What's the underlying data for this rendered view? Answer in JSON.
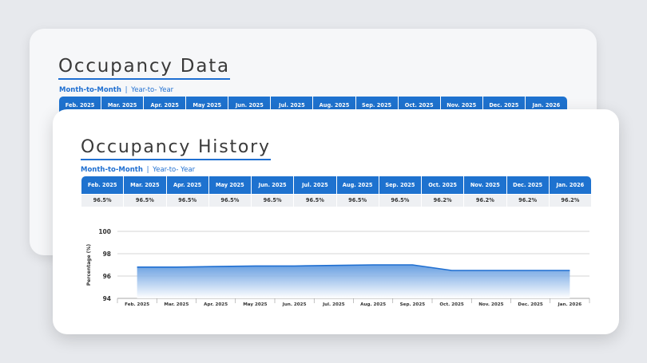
{
  "back_card": {
    "title": "Occupancy Data",
    "toggle": {
      "active": "Month-to-Month",
      "separator": "|",
      "inactive": "Year-to- Year"
    },
    "months": [
      "Feb. 2025",
      "Mar. 2025",
      "Apr. 2025",
      "May 2025",
      "Jun. 2025",
      "Jul. 2025",
      "Aug. 2025",
      "Sep. 2025",
      "Oct. 2025",
      "Nov. 2025",
      "Dec. 2025",
      "Jan. 2026"
    ]
  },
  "front_card": {
    "title": "Occupancy History",
    "toggle": {
      "active": "Month-to-Month",
      "separator": "|",
      "inactive": "Year-to- Year"
    },
    "months": [
      "Feb. 2025",
      "Mar. 2025",
      "Apr. 2025",
      "May 2025",
      "Jun. 2025",
      "Jul. 2025",
      "Aug. 2025",
      "Sep. 2025",
      "Oct. 2025",
      "Nov. 2025",
      "Dec. 2025",
      "Jan. 2026"
    ],
    "values": [
      "96.5%",
      "96.5%",
      "96.5%",
      "96.5%",
      "96.5%",
      "96.5%",
      "96.5%",
      "96.5%",
      "96.2%",
      "96.2%",
      "96.2%",
      "96.2%"
    ]
  },
  "colors": {
    "accent": "#1e72cf",
    "line": "#1f6fd1"
  },
  "chart_data": {
    "type": "area",
    "ylabel": "Percentage (%)",
    "xlabel": "",
    "title": "",
    "ylim": [
      94,
      100
    ],
    "yticks": [
      94,
      96,
      98,
      100
    ],
    "categories": [
      "Feb. 2025",
      "Mar. 2025",
      "Apr. 2025",
      "May 2025",
      "Jun. 2025",
      "Jul. 2025",
      "Aug. 2025",
      "Sep. 2025",
      "Oct. 2025",
      "Nov. 2025",
      "Dec. 2025",
      "Jan. 2026"
    ],
    "series": [
      {
        "values": [
          96.8,
          96.8,
          96.85,
          96.9,
          96.9,
          96.95,
          97.0,
          97.0,
          96.5,
          96.5,
          96.5,
          96.5
        ]
      }
    ],
    "grid": true
  }
}
